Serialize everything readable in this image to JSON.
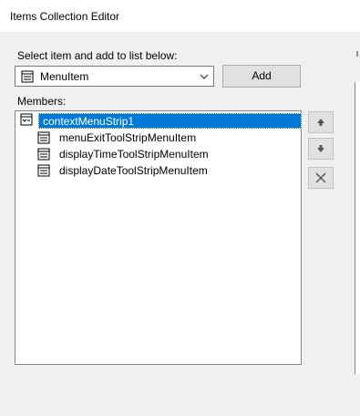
{
  "window": {
    "title": "Items Collection Editor"
  },
  "selector": {
    "label": "Select item and add to list below:",
    "selected": "MenuItem",
    "add_label": "Add"
  },
  "members": {
    "label": "Members:",
    "root": "contextMenuStrip1",
    "children": [
      "menuExitToolStripMenuItem",
      "displayTimeToolStripMenuItem",
      "displayDateToolStripMenuItem"
    ]
  },
  "icons": {
    "root": "context-menu-strip-icon",
    "item": "menu-item-icon",
    "move_up": "arrow-up-icon",
    "move_down": "arrow-down-icon",
    "remove": "delete-x-icon"
  },
  "colors": {
    "selection": "#0078d7"
  }
}
